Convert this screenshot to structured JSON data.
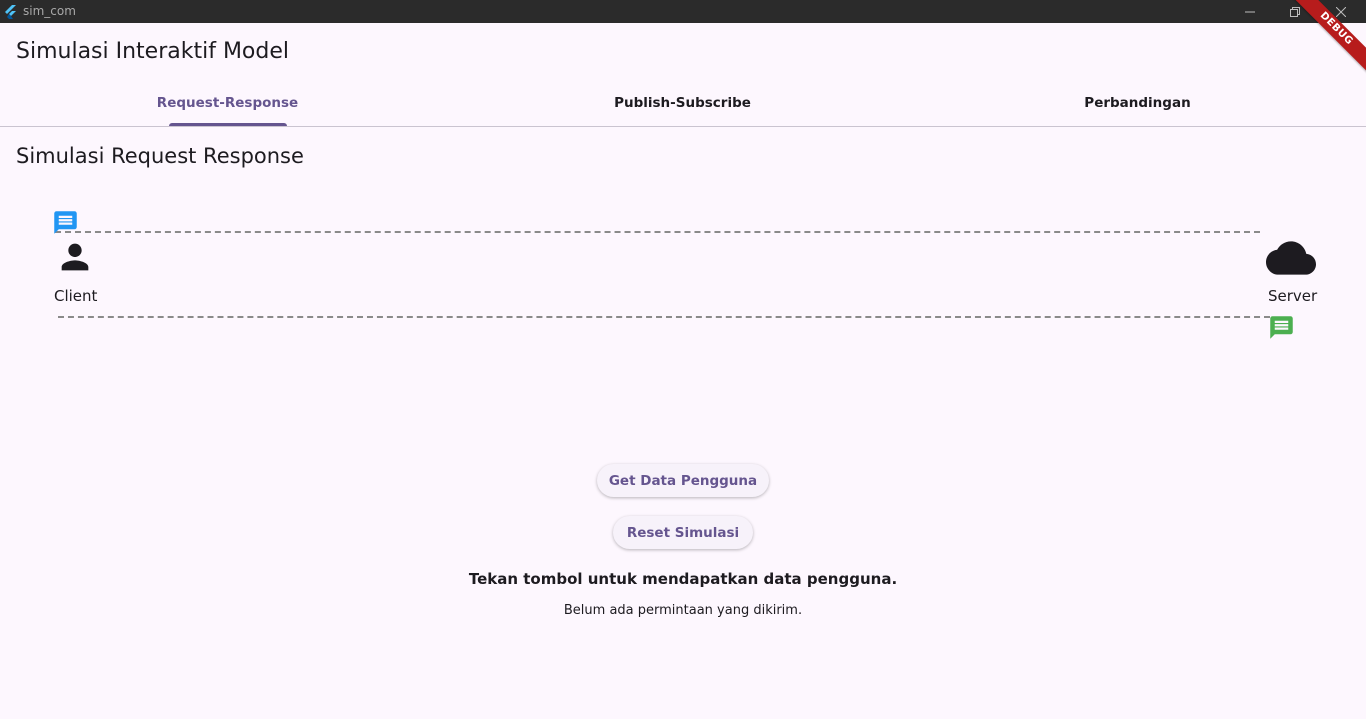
{
  "window": {
    "title": "sim_com",
    "debug_label": "DEBUG"
  },
  "app": {
    "title": "Simulasi Interaktif Model"
  },
  "tabs": [
    {
      "label": "Request-Response",
      "active": true
    },
    {
      "label": "Publish-Subscribe",
      "active": false
    },
    {
      "label": "Perbandingan",
      "active": false
    }
  ],
  "simulation": {
    "title": "Simulasi Request Response",
    "client": {
      "label": "Client",
      "icon": "person-icon"
    },
    "server": {
      "label": "Server",
      "icon": "cloud-icon"
    },
    "request_message": {
      "icon": "message-icon",
      "color": "#2196f3"
    },
    "response_message": {
      "icon": "message-icon",
      "color": "#4caf50"
    }
  },
  "actions": {
    "get_data_label": "Get Data Pengguna",
    "reset_label": "Reset Simulasi"
  },
  "status": {
    "main": "Tekan tombol untuk mendapatkan data pengguna.",
    "sub": "Belum ada permintaan yang dikirim."
  },
  "colors": {
    "accent": "#65558f",
    "background": "#fdf7fe",
    "titlebar": "#2b2b2b",
    "debug_banner": "#b71c1c"
  }
}
